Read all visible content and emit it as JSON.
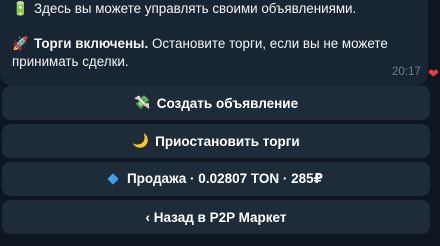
{
  "message": {
    "line1": {
      "icon": "🔋",
      "text": "Здесь вы можете управлять своими объявлениями."
    },
    "line2": {
      "icon": "🚀",
      "bold": "Торги включены.",
      "text": " Остановите торги, если вы не можете"
    },
    "line3": {
      "text": "принимать сделки."
    },
    "time": "20:17",
    "reaction": "❤"
  },
  "keyboard": {
    "create": {
      "icon": "💸",
      "label": "Создать объявление"
    },
    "pause": {
      "icon": "🌙",
      "label": "Приостановить торги"
    },
    "sell": {
      "label": "Продажа · 0.02807 TON · 285₽"
    },
    "back": {
      "label": "‹ Назад в P2P Маркет"
    }
  },
  "colors": {
    "background": "#0e1621",
    "bubble": "#182533",
    "button": "#1e2c3a",
    "accent": "#3fa0f0"
  }
}
